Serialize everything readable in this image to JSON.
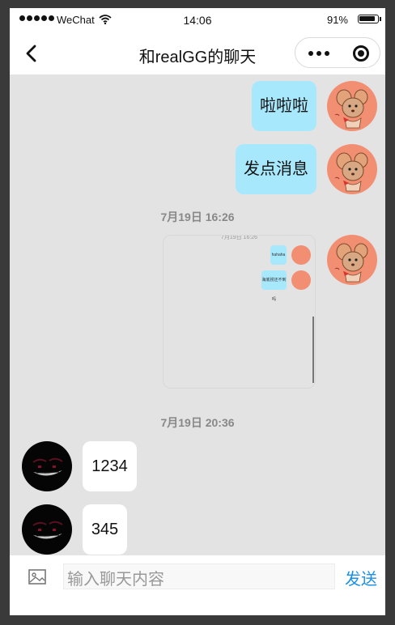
{
  "status_bar": {
    "carrier": "WeChat",
    "time": "14:06",
    "battery_percent": "91%",
    "battery_level": 0.91,
    "signal_icon": "signal-dots-icon",
    "wifi_icon": "wifi-icon"
  },
  "nav": {
    "title": "和realGG的聊天",
    "back_icon": "chevron-left-icon",
    "more_icon": "more-dots-icon",
    "close_icon": "target-close-icon"
  },
  "messages": [
    {
      "side": "mine",
      "text": "啦啦啦"
    },
    {
      "side": "mine",
      "text": "发点消息"
    }
  ],
  "timestamps": [
    "7月19日 16:26",
    "7月19日 20:36"
  ],
  "image_message": {
    "side": "mine",
    "thumbnail_timestamp": "7月19日 16:26",
    "thumbnail_texts": [
      "hahaha",
      "海底捞还不到吗"
    ]
  },
  "messages_other": [
    {
      "side": "other",
      "text": "1234"
    },
    {
      "side": "other",
      "text": "345"
    }
  ],
  "input_bar": {
    "image_icon": "image-icon",
    "placeholder": "输入聊天内容",
    "value": "",
    "send_label": "发送"
  },
  "colors": {
    "mine_bubble": "#a8e8fc",
    "other_bubble": "#ffffff",
    "chat_background": "#e3e3e3",
    "send_link": "#1a90e6",
    "mine_avatar_bg": "#f28f73"
  }
}
